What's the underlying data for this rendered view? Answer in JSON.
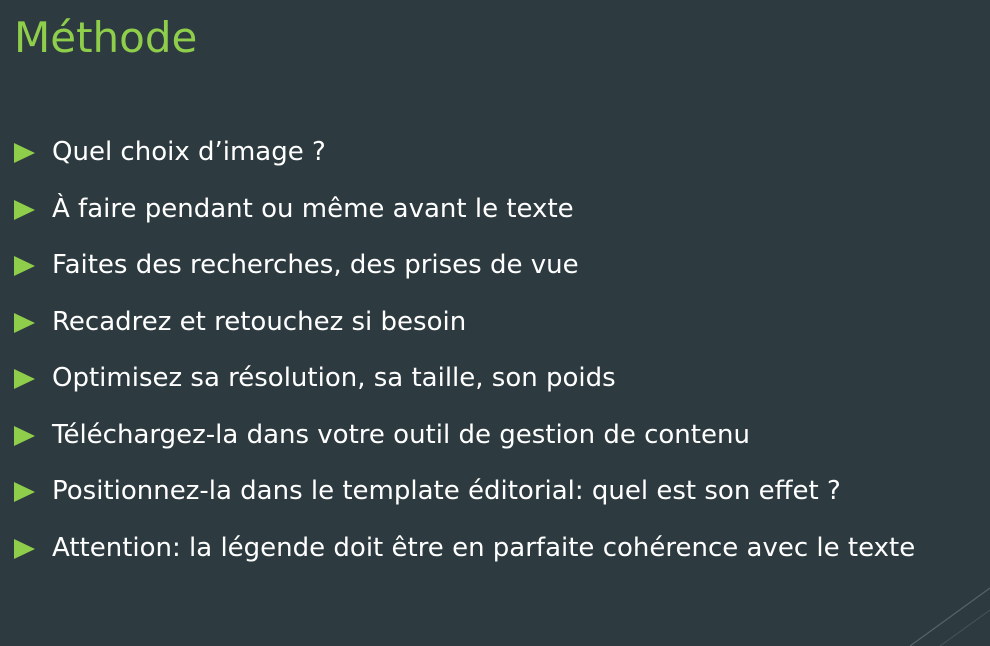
{
  "slide": {
    "title": "Méthode",
    "bullets": [
      {
        "text": "Quel choix d’image ?"
      },
      {
        "text": "À faire pendant ou même avant le texte"
      },
      {
        "text": "Faites des recherches, des prises de vue"
      },
      {
        "text": "Recadrez et retouchez si besoin"
      },
      {
        "text": "Optimisez sa résolution, sa taille, son poids"
      },
      {
        "text": "Téléchargez-la dans votre outil de gestion de contenu"
      },
      {
        "text": "Positionnez-la dans le template éditorial: quel est son effet ?"
      },
      {
        "text": "Attention: la légende doit être en parfaite cohérence avec le texte"
      }
    ]
  },
  "theme": {
    "background": "#2d3b40",
    "title_color": "#8fce4a",
    "bullet_color": "#8fce4a",
    "text_color": "#ffffff",
    "bullet_icon": "play-triangle-icon"
  }
}
